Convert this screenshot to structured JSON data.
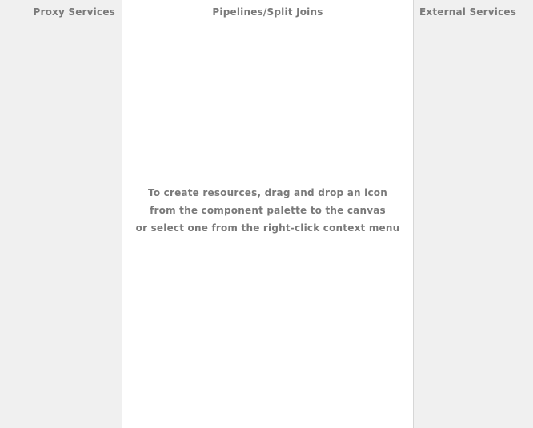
{
  "lanes": {
    "proxy": {
      "title": "Proxy Services"
    },
    "pipelines": {
      "title": "Pipelines/Split Joins"
    },
    "external": {
      "title": "External Services"
    }
  },
  "canvas_hint": {
    "lines": [
      "To create resources, drag and drop an icon",
      "from the component palette to the canvas",
      "or select one from the right-click context menu"
    ]
  }
}
